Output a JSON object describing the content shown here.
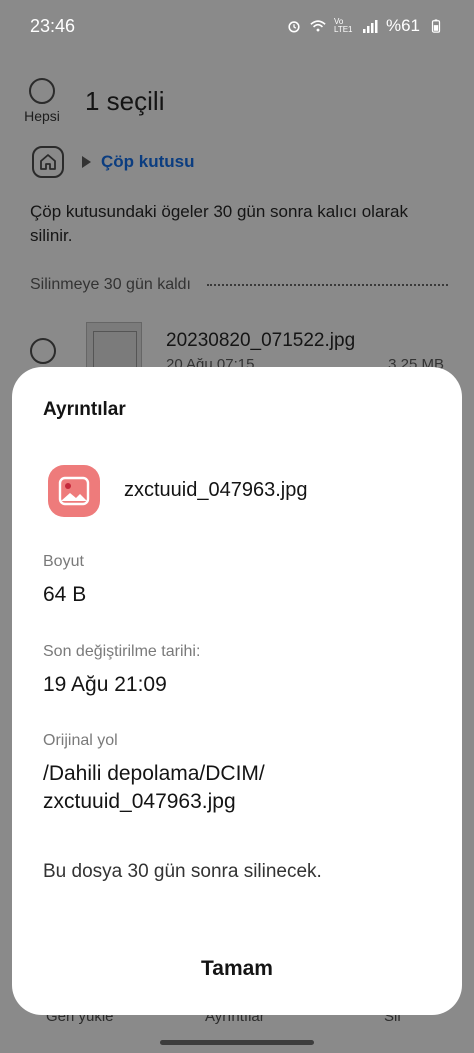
{
  "status_bar": {
    "time": "23:46",
    "battery": "%61",
    "network_label": "Vo LTE1"
  },
  "header": {
    "select_all_label": "Hepsi",
    "selected_count": "1 seçili"
  },
  "breadcrumb": {
    "label": "Çöp kutusu"
  },
  "trash_note": "Çöp kutusundaki ögeler 30 gün sonra kalıcı olarak silinir.",
  "section": {
    "title": "Silinmeye 30 gün kaldı"
  },
  "file_row": {
    "name": "20230820_071522.jpg",
    "date": "20 Ağu 07:15",
    "size": "3,25 MB"
  },
  "bottom_bar": {
    "restore": "Geri yükle",
    "details": "Ayrıntılar",
    "delete": "Sil"
  },
  "dialog": {
    "title": "Ayrıntılar",
    "file_name": "zxctuuid_047963.jpg",
    "size_label": "Boyut",
    "size_value": "64 B",
    "modified_label": "Son değiştirilme tarihi:",
    "modified_value": "19 Ağu 21:09",
    "path_label": "Orijinal yol",
    "path_value_1": "/Dahili depolama/DCIM/",
    "path_value_2": "zxctuuid_047963.jpg",
    "delete_note": "Bu dosya 30 gün sonra silinecek.",
    "ok_label": "Tamam"
  },
  "colors": {
    "accent_link": "#0b3d80",
    "file_icon": "#ee7b7b",
    "scrim": "#8a8a8a"
  }
}
